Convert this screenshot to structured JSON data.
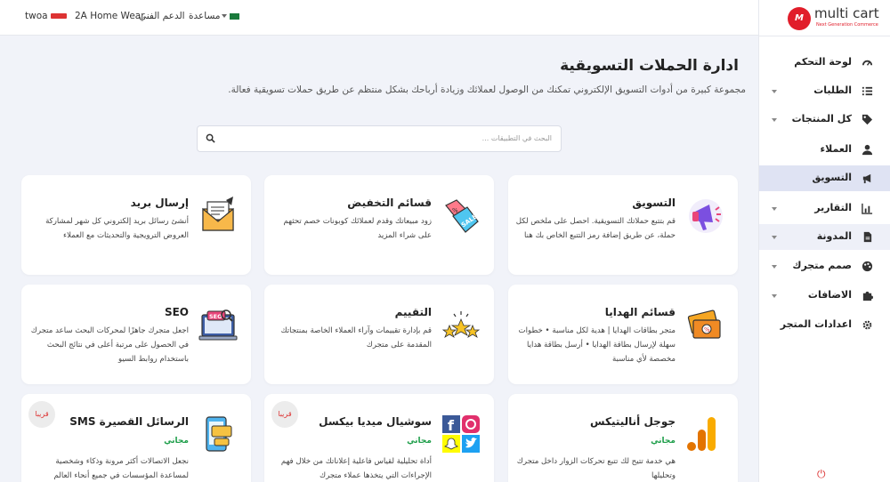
{
  "topbar": {
    "store_1": "twoa",
    "store_2": "2A Home Wear",
    "support": "الدعم الفني",
    "help": "مساعدة"
  },
  "brand": {
    "name": "multi cart",
    "tagline": "Next Generation Commerce",
    "mark": "M"
  },
  "sidebar": {
    "items": [
      {
        "label": "لوحة التحكم",
        "icon": "dashboard-icon"
      },
      {
        "label": "الطلبات",
        "icon": "orders-icon"
      },
      {
        "label": "كل المنتجات",
        "icon": "tag-icon"
      },
      {
        "label": "العملاء",
        "icon": "user-icon"
      },
      {
        "label": "التسويق",
        "icon": "megaphone-icon"
      },
      {
        "label": "التقارير",
        "icon": "chart-icon"
      },
      {
        "label": "المدونة",
        "icon": "document-icon"
      },
      {
        "label": "صمم متجرك",
        "icon": "palette-icon"
      },
      {
        "label": "الاضافات",
        "icon": "puzzle-icon"
      },
      {
        "label": "اعدادات المتجر",
        "icon": "gear-icon"
      }
    ]
  },
  "main": {
    "title": "ادارة الحملات التسويقية",
    "description": "مجموعة كبيرة من أدوات التسويق الإلكتروني تمكنك من الوصول لعملائك وزيادة أرباحك بشكل منتظم عن طريق حملات تسويقية فعالة.",
    "search_placeholder": "البحث في التطبيقات ..."
  },
  "cards": [
    {
      "title": "التسويق",
      "desc": "قم بتتبع حملاتك التسويقية. احصل على ملخص لكل حملة، عن طريق إضافة رمز التتبع الخاص بك هنا",
      "icon": "megaphone-icon"
    },
    {
      "title": "قسائم التخفيض",
      "desc": "زود مبيعاتك وقدم لعملائك كوبونات خصم تحثهم على شراء المزيد",
      "icon": "sale-tag-icon"
    },
    {
      "title": "إرسال بريد",
      "desc": "أنشئ رسائل بريد إلكتروني كل شهر لمشاركة العروض الترويجية والتحديثات مع العملاء",
      "icon": "envelope-icon"
    },
    {
      "title": "قسائم الهدايا",
      "desc": "متجر بطاقات الهدايا | هدية لكل مناسبة • خطوات سهلة لإرسال بطاقة الهدايا • أرسل بطاقة هدايا مخصصة لأي مناسبة",
      "icon": "gift-card-icon"
    },
    {
      "title": "التقييم",
      "desc": "قم بإدارة تقييمات وآراء العملاء الخاصة بمنتجاتك المقدمة على متجرك",
      "icon": "stars-icon"
    },
    {
      "title": "SEO",
      "desc": "اجعل متجرك جاهزًا لمحركات البحث ساعد متجرك في الحصول على مرتبة أعلى في نتائج البحث باستخدام روابط السيو",
      "icon": "seo-icon"
    },
    {
      "title": "جوجل أناليتيكس",
      "free": "مجاني",
      "desc": "هي خدمة تتيح لك تتبع تحركات الزوار داخل متجرك وتحليلها",
      "icon": "analytics-icon"
    },
    {
      "title": "سوشيال ميديا بيكسل",
      "free": "مجاني",
      "badge": "قريبا",
      "desc": "أداة تحليلية لقياس فاعلية إعلاناتك من خلال فهم الإجراءات التي يتخذها عملاء متجرك",
      "icon": "social-icons"
    },
    {
      "title": "الرسائل القصيرة SMS",
      "free": "مجاني",
      "badge": "قريبا",
      "desc": "نجعل الاتصالات أكثر مرونة وذكاء وشخصية لمساعدة المؤسسات في جميع أنحاء العالم",
      "icon": "sms-icon"
    }
  ],
  "colors": {
    "brand": "#e11d2a",
    "active_nav": "#dfe3f3",
    "free_green": "#1e9e4a",
    "background": "#f1f3f9"
  }
}
